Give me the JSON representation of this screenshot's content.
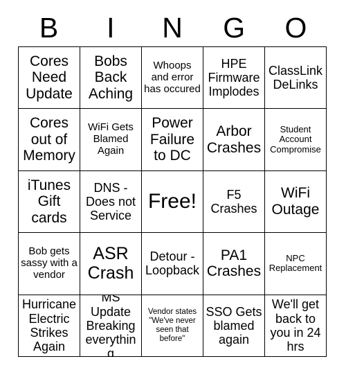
{
  "card": {
    "title_letters": [
      "B",
      "I",
      "N",
      "G",
      "O"
    ],
    "columns": 5,
    "rows": 5,
    "text_color": "#000000",
    "cell_background": "#ffffff",
    "border_color": "#000000",
    "free_space_label": "Free!",
    "free_space_position": {
      "row": 3,
      "column": 3
    }
  },
  "cells": [
    {
      "id": "b1",
      "text": "Cores Need Update",
      "size": "lg"
    },
    {
      "id": "i1",
      "text": "Bobs Back Aching",
      "size": "lg"
    },
    {
      "id": "n1",
      "text": "Whoops and error has occured",
      "size": "sm"
    },
    {
      "id": "g1",
      "text": "HPE Firmware Implodes",
      "size": "md"
    },
    {
      "id": "o1",
      "text": "ClassLink DeLinks",
      "size": "md"
    },
    {
      "id": "b2",
      "text": "Cores out of Memory",
      "size": "lg"
    },
    {
      "id": "i2",
      "text": "WiFi Gets Blamed Again",
      "size": "sm"
    },
    {
      "id": "n2",
      "text": "Power Failure to DC",
      "size": "lg"
    },
    {
      "id": "g2",
      "text": "Arbor Crashes",
      "size": "lg"
    },
    {
      "id": "o2",
      "text": "Student Account Compromise",
      "size": "xs"
    },
    {
      "id": "b3",
      "text": "iTunes Gift cards",
      "size": "lg"
    },
    {
      "id": "i3",
      "text": "DNS - Does not Service",
      "size": "md"
    },
    {
      "id": "n3",
      "text": "Free!",
      "size": "xxl"
    },
    {
      "id": "g3",
      "text": "F5 Crashes",
      "size": "md"
    },
    {
      "id": "o3",
      "text": "WiFi Outage",
      "size": "lg"
    },
    {
      "id": "b4",
      "text": "Bob gets sassy with a vendor",
      "size": "sm"
    },
    {
      "id": "i4",
      "text": "ASR Crash",
      "size": "xl"
    },
    {
      "id": "n4",
      "text": "Detour - Loopback",
      "size": "md"
    },
    {
      "id": "g4",
      "text": "PA1 Crashes",
      "size": "lg"
    },
    {
      "id": "o4",
      "text": "NPC Replacement",
      "size": "xs"
    },
    {
      "id": "b5",
      "text": "Hurricane Electric Strikes Again",
      "size": "md"
    },
    {
      "id": "i5",
      "text": "MS Update Breaking everything",
      "size": "md"
    },
    {
      "id": "n5",
      "text": "Vendor states \"We've never seen that before\"",
      "size": "xxs"
    },
    {
      "id": "g5",
      "text": "SSO Gets blamed again",
      "size": "md"
    },
    {
      "id": "o5",
      "text": "We'll get back to you in 24 hrs",
      "size": "md"
    }
  ]
}
